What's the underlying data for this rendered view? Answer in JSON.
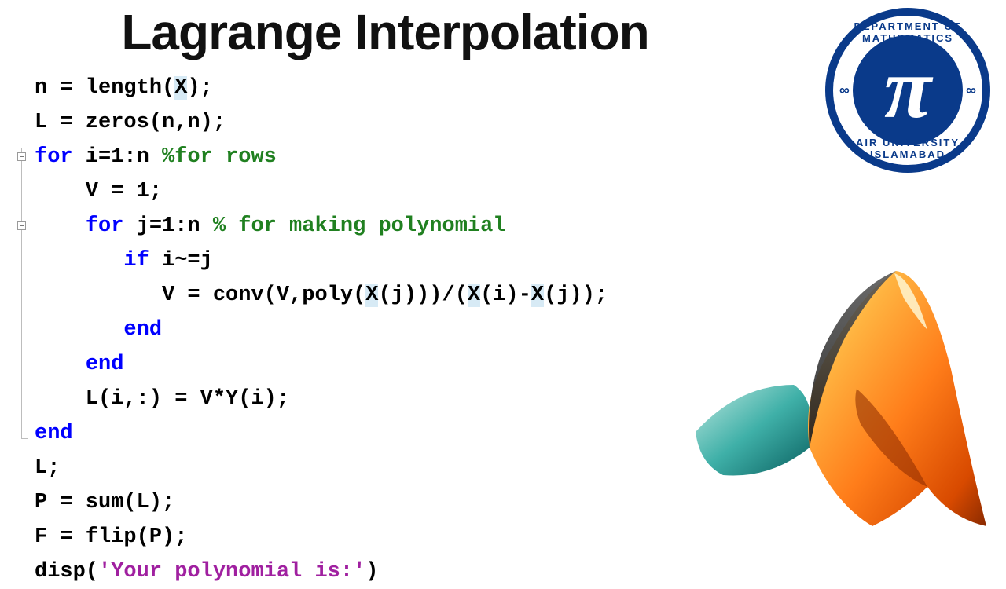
{
  "title": "Lagrange Interpolation",
  "logo": {
    "top_text": "DEPARTMENT OF MATHEMATICS",
    "bottom_text": "AIR UNIVERSITY ISLAMABAD",
    "side_symbol": "∞",
    "center_symbol": "π"
  },
  "code": {
    "l1_a": "n = length(",
    "l1_hl": "X",
    "l1_b": ");",
    "l2": "L = zeros(n,n);",
    "l3_kw": "for",
    "l3_body": " i=1:n ",
    "l3_cm": "%for rows",
    "l4": "    V = 1;",
    "l5_pad": "    ",
    "l5_kw": "for",
    "l5_body": " j=1:n ",
    "l5_cm": "% for making polynomial",
    "l6_pad": "       ",
    "l6_kw": "if",
    "l6_body": " i~=j",
    "l7_a": "          V = conv(V,poly(",
    "l7_h1": "X",
    "l7_b": "(j)))/(",
    "l7_h2": "X",
    "l7_c": "(i)-",
    "l7_h3": "X",
    "l7_d": "(j));",
    "l8_pad": "       ",
    "l8_kw": "end",
    "l9_pad": "    ",
    "l9_kw": "end",
    "l10": "    L(i,:) = V*Y(i);",
    "l11_kw": "end",
    "l12": "L;",
    "l13": "P = sum(L);",
    "l14": "F = flip(P);",
    "l15_a": "disp(",
    "l15_str": "'Your polynomial is:'",
    "l15_b": ")"
  }
}
